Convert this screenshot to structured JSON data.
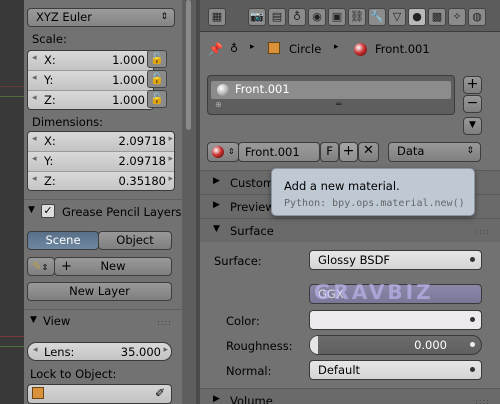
{
  "left": {
    "rotation_mode": "XYZ Euler",
    "scale_label": "Scale:",
    "scale": [
      {
        "axis": "X:",
        "value": "1.000"
      },
      {
        "axis": "Y:",
        "value": "1.000"
      },
      {
        "axis": "Z:",
        "value": "1.000"
      }
    ],
    "dimensions_label": "Dimensions:",
    "dimensions": [
      {
        "axis": "X:",
        "value": "2.09718"
      },
      {
        "axis": "Y:",
        "value": "2.09718"
      },
      {
        "axis": "Z:",
        "value": "0.35180"
      }
    ],
    "grease_pencil": "Grease Pencil Layers",
    "scene_btn": "Scene",
    "object_btn": "Object",
    "new_btn": "New",
    "new_layer_btn": "New Layer",
    "view_header": "View",
    "lens_label": "Lens:",
    "lens_value": "35.000",
    "lock_to_object": "Lock to Object:"
  },
  "right": {
    "breadcrumb_object": "Circle",
    "breadcrumb_material": "Front.001",
    "slot_name": "Front.001",
    "material_field": "Front.001",
    "fake_user": "F",
    "link_mode": "Data",
    "panels": {
      "custom": "Custom",
      "preview": "Preview",
      "surface": "Surface",
      "volume": "Volume"
    },
    "surface_label": "Surface:",
    "surface_value": "Glossy BSDF",
    "distribution_value": "GGX",
    "color_label": "Color:",
    "roughness_label": "Roughness:",
    "roughness_value": "0.000",
    "normal_label": "Normal:",
    "normal_value": "Default",
    "watermark": "GRAVBIZ"
  },
  "tooltip": {
    "title": "Add a new material.",
    "python": "Python: bpy.ops.material.new()"
  }
}
